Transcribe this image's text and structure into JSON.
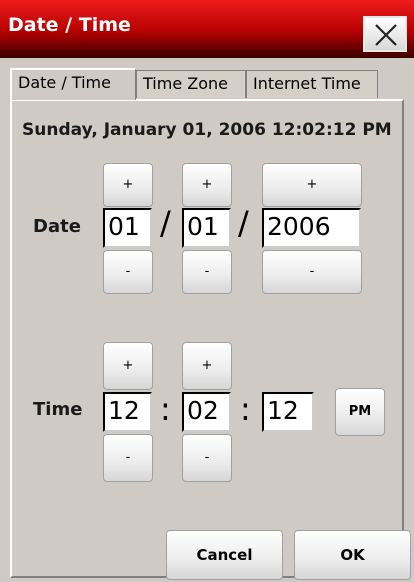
{
  "window": {
    "title": "Date / Time"
  },
  "tabs": [
    {
      "label": "Date / Time",
      "active": true
    },
    {
      "label": "Time Zone",
      "active": false
    },
    {
      "label": "Internet Time",
      "active": false
    }
  ],
  "current_datetime": "Sunday, January 01, 2006 12:02:12 PM",
  "date": {
    "label": "Date",
    "month": "01",
    "day": "01",
    "year": "2006",
    "separator": "/"
  },
  "time": {
    "label": "Time",
    "hour": "12",
    "minute": "02",
    "second": "12",
    "separator": ":",
    "ampm": "PM"
  },
  "buttons": {
    "increment": "+",
    "decrement": "-",
    "cancel": "Cancel",
    "ok": "OK"
  },
  "icons": {
    "close": "close-icon"
  }
}
